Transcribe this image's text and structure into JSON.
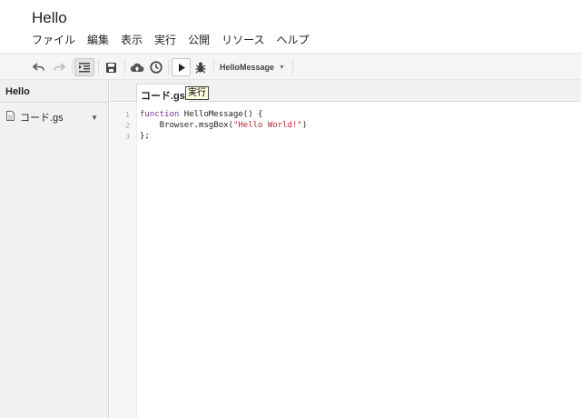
{
  "app": {
    "title": "Hello"
  },
  "menu": [
    "ファイル",
    "編集",
    "表示",
    "実行",
    "公開",
    "リソース",
    "ヘルプ"
  ],
  "toolbar": {
    "selected_function": "HelloMessage",
    "icons": [
      "undo-icon",
      "redo-icon",
      "indent-icon",
      "save-icon",
      "deploy-cloud-icon",
      "triggers-clock-icon",
      "run-icon",
      "debug-bug-icon"
    ]
  },
  "sidebar": {
    "project_title": "Hello",
    "files": [
      {
        "name": "コード.gs"
      }
    ]
  },
  "editor": {
    "active_tab": "コード.gs",
    "tooltip": "実行",
    "line_numbers": [
      "1",
      "2",
      "3"
    ],
    "code": {
      "l1_kw": "function",
      "l1_rest": " HelloMessage() {",
      "l2_pre": "    Browser.msgBox(",
      "l2_str": "\"Hello World!\"",
      "l2_post": ")",
      "l3": "};"
    }
  },
  "colors": {
    "keyword": "#7a2a96",
    "string": "#b8272c",
    "toolbar_bg": "#f5f5f5",
    "sidebar_bg": "#f1f1f1"
  }
}
